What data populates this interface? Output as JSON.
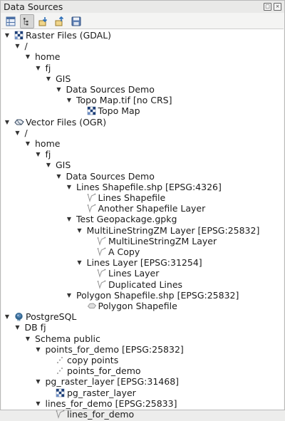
{
  "panel": {
    "title": "Data Sources"
  },
  "toolbar": {
    "tools": [
      {
        "icon": "table-icon",
        "active": false
      },
      {
        "icon": "expand-tree-icon",
        "active": true
      },
      {
        "icon": "import-icon",
        "active": false
      },
      {
        "icon": "export-icon",
        "active": false
      },
      {
        "icon": "save-icon",
        "active": false
      }
    ]
  },
  "tree": {
    "rows": [
      {
        "label": "Raster Files (GDAL)",
        "depth": 0,
        "arrow": true,
        "icon": "raster-icon"
      },
      {
        "label": "/",
        "depth": 1,
        "arrow": true,
        "icon": ""
      },
      {
        "label": "home",
        "depth": 2,
        "arrow": true,
        "icon": ""
      },
      {
        "label": "fj",
        "depth": 3,
        "arrow": true,
        "icon": ""
      },
      {
        "label": "GIS",
        "depth": 4,
        "arrow": true,
        "icon": ""
      },
      {
        "label": "Data Sources Demo",
        "depth": 5,
        "arrow": true,
        "icon": ""
      },
      {
        "label": "Topo Map.tif [no CRS]",
        "depth": 6,
        "arrow": true,
        "icon": ""
      },
      {
        "label": "Topo Map",
        "depth": 7,
        "arrow": false,
        "icon": "raster-icon"
      },
      {
        "label": "Vector Files (OGR)",
        "depth": 0,
        "arrow": true,
        "icon": "vector-icon"
      },
      {
        "label": "/",
        "depth": 1,
        "arrow": true,
        "icon": ""
      },
      {
        "label": "home",
        "depth": 2,
        "arrow": true,
        "icon": ""
      },
      {
        "label": "fj",
        "depth": 3,
        "arrow": true,
        "icon": ""
      },
      {
        "label": "GIS",
        "depth": 4,
        "arrow": true,
        "icon": ""
      },
      {
        "label": "Data Sources Demo",
        "depth": 5,
        "arrow": true,
        "icon": ""
      },
      {
        "label": "Lines Shapefile.shp [EPSG:4326]",
        "depth": 6,
        "arrow": true,
        "icon": ""
      },
      {
        "label": "Lines Shapefile",
        "depth": 7,
        "arrow": false,
        "icon": "line-layer-icon"
      },
      {
        "label": "Another Shapefile Layer",
        "depth": 7,
        "arrow": false,
        "icon": "line-layer-icon"
      },
      {
        "label": "Test Geopackage.gpkg",
        "depth": 6,
        "arrow": true,
        "icon": ""
      },
      {
        "label": "MultiLineStringZM Layer [EPSG:25832]",
        "depth": 7,
        "arrow": true,
        "icon": ""
      },
      {
        "label": "MultiLineStringZM Layer",
        "depth": 8,
        "arrow": false,
        "icon": "line-layer-icon"
      },
      {
        "label": "A Copy",
        "depth": 8,
        "arrow": false,
        "icon": "line-layer-icon"
      },
      {
        "label": "Lines Layer [EPSG:31254]",
        "depth": 7,
        "arrow": true,
        "icon": ""
      },
      {
        "label": "Lines Layer",
        "depth": 8,
        "arrow": false,
        "icon": "line-layer-icon"
      },
      {
        "label": "Duplicated Lines",
        "depth": 8,
        "arrow": false,
        "icon": "line-layer-icon"
      },
      {
        "label": "Polygon Shapefile.shp [EPSG:25832]",
        "depth": 6,
        "arrow": true,
        "icon": ""
      },
      {
        "label": "Polygon Shapefile",
        "depth": 7,
        "arrow": false,
        "icon": "polygon-layer-icon"
      },
      {
        "label": "PostgreSQL",
        "depth": 0,
        "arrow": true,
        "icon": "postgres-icon"
      },
      {
        "label": "DB fj",
        "depth": 1,
        "arrow": true,
        "icon": ""
      },
      {
        "label": "Schema public",
        "depth": 2,
        "arrow": true,
        "icon": ""
      },
      {
        "label": "points_for_demo [EPSG:25832]",
        "depth": 3,
        "arrow": true,
        "icon": ""
      },
      {
        "label": "copy points",
        "depth": 4,
        "arrow": false,
        "icon": "point-layer-icon"
      },
      {
        "label": "points_for_demo",
        "depth": 4,
        "arrow": false,
        "icon": "point-layer-icon"
      },
      {
        "label": "pg_raster_layer [EPSG:31468]",
        "depth": 3,
        "arrow": true,
        "icon": ""
      },
      {
        "label": "pg_raster_layer",
        "depth": 4,
        "arrow": false,
        "icon": "raster-icon"
      },
      {
        "label": "lines_for_demo [EPSG:25833]",
        "depth": 3,
        "arrow": true,
        "icon": ""
      },
      {
        "label": "lines_for_demo",
        "depth": 4,
        "arrow": false,
        "icon": "line-layer-icon"
      }
    ]
  }
}
